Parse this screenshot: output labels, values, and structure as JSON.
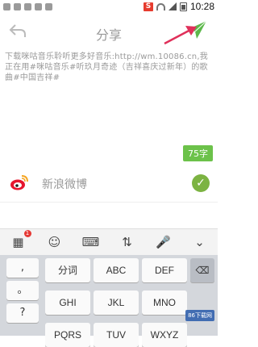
{
  "status": {
    "time": "10:28",
    "s_label": "S"
  },
  "header": {
    "title": "分享"
  },
  "share_text": "下载咪咕音乐聆听更多好音乐:http://wm.10086.cn,我正在用#咪咕音乐#听玖月奇迹（吉祥喜庆过新年）的歌曲#中国吉祥#",
  "char_count": "75字",
  "weibo": {
    "label": "新浪微博"
  },
  "keyboard": {
    "left_keys": [
      ",",
      "。",
      "?"
    ],
    "rows": [
      [
        "分词",
        "ABC",
        "DEF"
      ],
      [
        "GHI",
        "JKL",
        "MNO"
      ],
      [
        "PQRS",
        "TUV",
        "WXYZ"
      ]
    ],
    "badge": "1"
  },
  "watermark": "86下载网"
}
